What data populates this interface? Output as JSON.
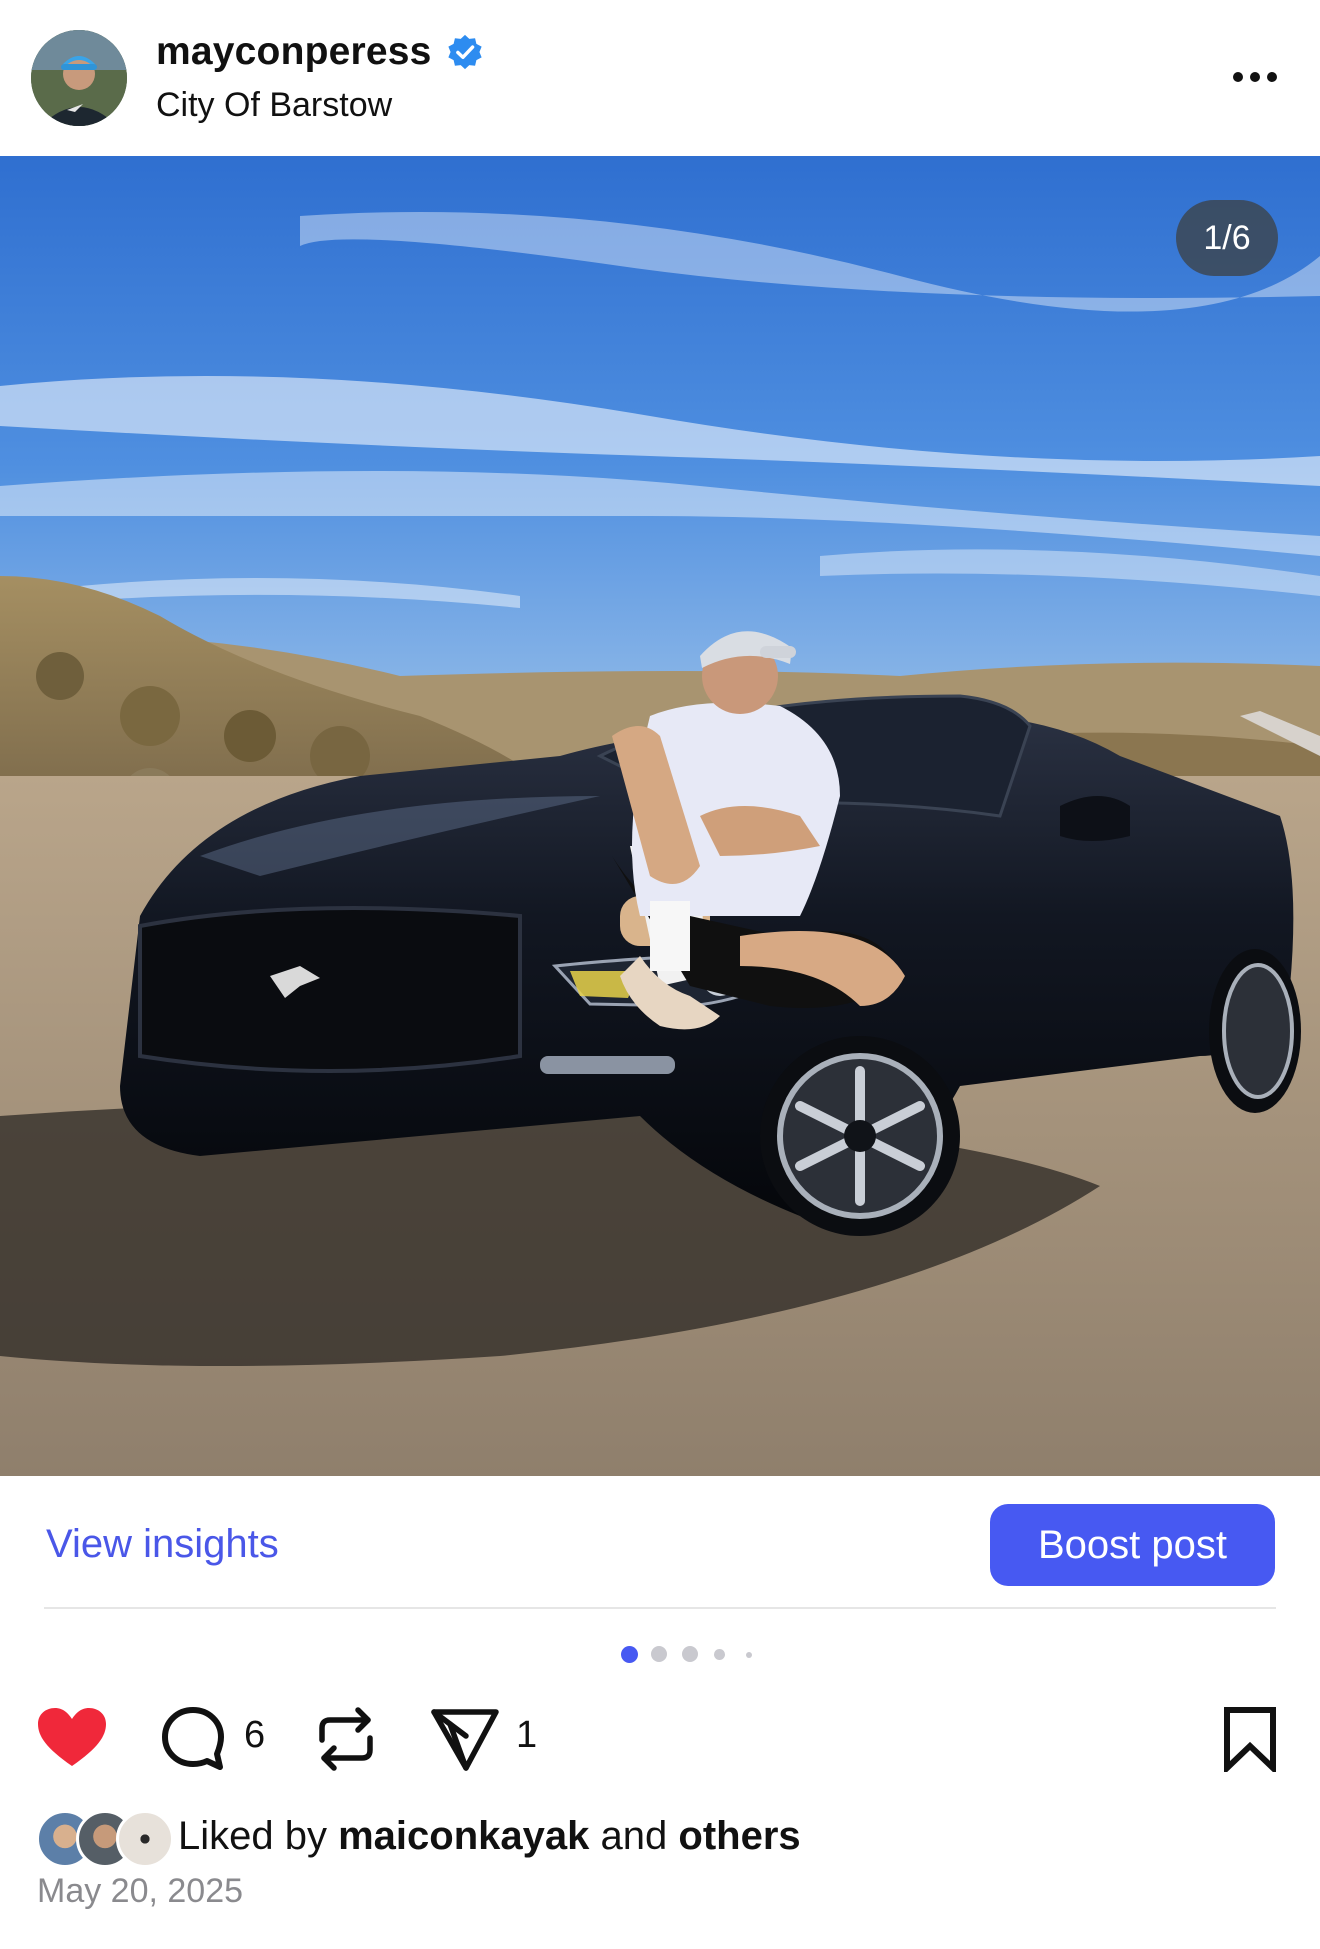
{
  "post": {
    "username": "mayconperess",
    "location": "City Of Barstow",
    "image_counter": "1/6",
    "date": "May 20, 2025"
  },
  "actions": {
    "view_insights": "View insights",
    "boost_post": "Boost post"
  },
  "carousel": {
    "current": 1,
    "visible_dots": 5
  },
  "engagement": {
    "comments_count": "6",
    "shares_count": "1",
    "liked_prefix": "Liked by",
    "liked_user": "maiconkayak",
    "liked_and": "and",
    "liked_others": "others"
  },
  "icons": {
    "verified": "verified-badge-icon",
    "more": "more-options-icon",
    "like": "heart-icon",
    "comment": "comment-icon",
    "repost": "repost-icon",
    "share": "send-icon",
    "save": "bookmark-icon"
  },
  "colors": {
    "accent": "#4759f2",
    "link": "#4a57e8",
    "like": "#f0283a",
    "verified": "#2d8cf0"
  }
}
